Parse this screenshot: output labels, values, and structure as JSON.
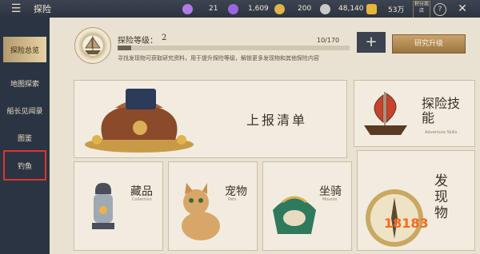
{
  "topbar": {
    "title": "探险",
    "resources": [
      {
        "icon": "purple-gem-icon",
        "value": "21",
        "color": "#b07be8"
      },
      {
        "icon": "purple-diamond-icon",
        "value": "1,609",
        "color": "#9a66e0"
      },
      {
        "icon": "gold-coin-icon",
        "value": "200",
        "color": "#e0b44a"
      },
      {
        "icon": "silver-coin-icon",
        "value": "48,140",
        "color": "#c9c9c9"
      },
      {
        "icon": "gold-ingot-icon",
        "value": "53万",
        "color": "#e8b43c"
      }
    ],
    "shop_label": "积分商店",
    "help_label": "?",
    "close_label": "✕"
  },
  "sidebar": {
    "items": [
      {
        "label": "探险总览",
        "active": true
      },
      {
        "label": "地图探索",
        "active": false
      },
      {
        "label": "船长见闻录",
        "active": false
      },
      {
        "label": "图鉴",
        "active": false
      },
      {
        "label": "钓鱼",
        "active": false
      }
    ]
  },
  "header": {
    "level_label": "探险等级：",
    "level_value": "2",
    "progress": "10/170",
    "progress_fraction": 0.0588,
    "description": "寻找发现物可获取研究资料，用于提升探险等级，解锁更多发现物和其他探险内容",
    "add_label": "+",
    "research_label": "研究升级"
  },
  "panels": {
    "report": {
      "title": "上报清单"
    },
    "skills": {
      "title": "探险技能",
      "subtitle": "Adventure Skills"
    },
    "collection": {
      "title": "藏品",
      "subtitle": "Collection"
    },
    "pets": {
      "title": "宠物",
      "subtitle": "Pets"
    },
    "mounts": {
      "title": "坐骑",
      "subtitle": "Mounts"
    },
    "discoveries": {
      "title": "发现物"
    }
  },
  "watermark": "18183"
}
